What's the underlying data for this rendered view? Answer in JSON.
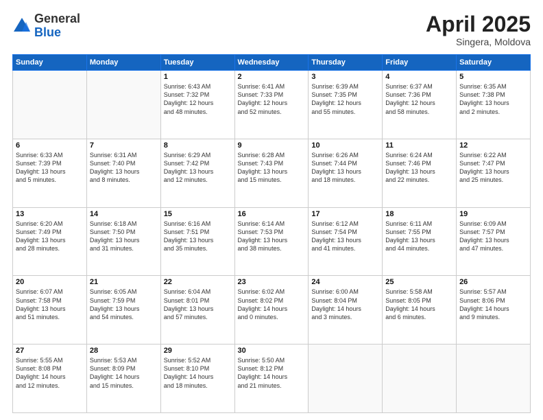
{
  "logo": {
    "general": "General",
    "blue": "Blue"
  },
  "header": {
    "month": "April 2025",
    "location": "Singera, Moldova"
  },
  "weekdays": [
    "Sunday",
    "Monday",
    "Tuesday",
    "Wednesday",
    "Thursday",
    "Friday",
    "Saturday"
  ],
  "weeks": [
    [
      {
        "day": "",
        "info": ""
      },
      {
        "day": "",
        "info": ""
      },
      {
        "day": "1",
        "info": "Sunrise: 6:43 AM\nSunset: 7:32 PM\nDaylight: 12 hours\nand 48 minutes."
      },
      {
        "day": "2",
        "info": "Sunrise: 6:41 AM\nSunset: 7:33 PM\nDaylight: 12 hours\nand 52 minutes."
      },
      {
        "day": "3",
        "info": "Sunrise: 6:39 AM\nSunset: 7:35 PM\nDaylight: 12 hours\nand 55 minutes."
      },
      {
        "day": "4",
        "info": "Sunrise: 6:37 AM\nSunset: 7:36 PM\nDaylight: 12 hours\nand 58 minutes."
      },
      {
        "day": "5",
        "info": "Sunrise: 6:35 AM\nSunset: 7:38 PM\nDaylight: 13 hours\nand 2 minutes."
      }
    ],
    [
      {
        "day": "6",
        "info": "Sunrise: 6:33 AM\nSunset: 7:39 PM\nDaylight: 13 hours\nand 5 minutes."
      },
      {
        "day": "7",
        "info": "Sunrise: 6:31 AM\nSunset: 7:40 PM\nDaylight: 13 hours\nand 8 minutes."
      },
      {
        "day": "8",
        "info": "Sunrise: 6:29 AM\nSunset: 7:42 PM\nDaylight: 13 hours\nand 12 minutes."
      },
      {
        "day": "9",
        "info": "Sunrise: 6:28 AM\nSunset: 7:43 PM\nDaylight: 13 hours\nand 15 minutes."
      },
      {
        "day": "10",
        "info": "Sunrise: 6:26 AM\nSunset: 7:44 PM\nDaylight: 13 hours\nand 18 minutes."
      },
      {
        "day": "11",
        "info": "Sunrise: 6:24 AM\nSunset: 7:46 PM\nDaylight: 13 hours\nand 22 minutes."
      },
      {
        "day": "12",
        "info": "Sunrise: 6:22 AM\nSunset: 7:47 PM\nDaylight: 13 hours\nand 25 minutes."
      }
    ],
    [
      {
        "day": "13",
        "info": "Sunrise: 6:20 AM\nSunset: 7:49 PM\nDaylight: 13 hours\nand 28 minutes."
      },
      {
        "day": "14",
        "info": "Sunrise: 6:18 AM\nSunset: 7:50 PM\nDaylight: 13 hours\nand 31 minutes."
      },
      {
        "day": "15",
        "info": "Sunrise: 6:16 AM\nSunset: 7:51 PM\nDaylight: 13 hours\nand 35 minutes."
      },
      {
        "day": "16",
        "info": "Sunrise: 6:14 AM\nSunset: 7:53 PM\nDaylight: 13 hours\nand 38 minutes."
      },
      {
        "day": "17",
        "info": "Sunrise: 6:12 AM\nSunset: 7:54 PM\nDaylight: 13 hours\nand 41 minutes."
      },
      {
        "day": "18",
        "info": "Sunrise: 6:11 AM\nSunset: 7:55 PM\nDaylight: 13 hours\nand 44 minutes."
      },
      {
        "day": "19",
        "info": "Sunrise: 6:09 AM\nSunset: 7:57 PM\nDaylight: 13 hours\nand 47 minutes."
      }
    ],
    [
      {
        "day": "20",
        "info": "Sunrise: 6:07 AM\nSunset: 7:58 PM\nDaylight: 13 hours\nand 51 minutes."
      },
      {
        "day": "21",
        "info": "Sunrise: 6:05 AM\nSunset: 7:59 PM\nDaylight: 13 hours\nand 54 minutes."
      },
      {
        "day": "22",
        "info": "Sunrise: 6:04 AM\nSunset: 8:01 PM\nDaylight: 13 hours\nand 57 minutes."
      },
      {
        "day": "23",
        "info": "Sunrise: 6:02 AM\nSunset: 8:02 PM\nDaylight: 14 hours\nand 0 minutes."
      },
      {
        "day": "24",
        "info": "Sunrise: 6:00 AM\nSunset: 8:04 PM\nDaylight: 14 hours\nand 3 minutes."
      },
      {
        "day": "25",
        "info": "Sunrise: 5:58 AM\nSunset: 8:05 PM\nDaylight: 14 hours\nand 6 minutes."
      },
      {
        "day": "26",
        "info": "Sunrise: 5:57 AM\nSunset: 8:06 PM\nDaylight: 14 hours\nand 9 minutes."
      }
    ],
    [
      {
        "day": "27",
        "info": "Sunrise: 5:55 AM\nSunset: 8:08 PM\nDaylight: 14 hours\nand 12 minutes."
      },
      {
        "day": "28",
        "info": "Sunrise: 5:53 AM\nSunset: 8:09 PM\nDaylight: 14 hours\nand 15 minutes."
      },
      {
        "day": "29",
        "info": "Sunrise: 5:52 AM\nSunset: 8:10 PM\nDaylight: 14 hours\nand 18 minutes."
      },
      {
        "day": "30",
        "info": "Sunrise: 5:50 AM\nSunset: 8:12 PM\nDaylight: 14 hours\nand 21 minutes."
      },
      {
        "day": "",
        "info": ""
      },
      {
        "day": "",
        "info": ""
      },
      {
        "day": "",
        "info": ""
      }
    ]
  ]
}
